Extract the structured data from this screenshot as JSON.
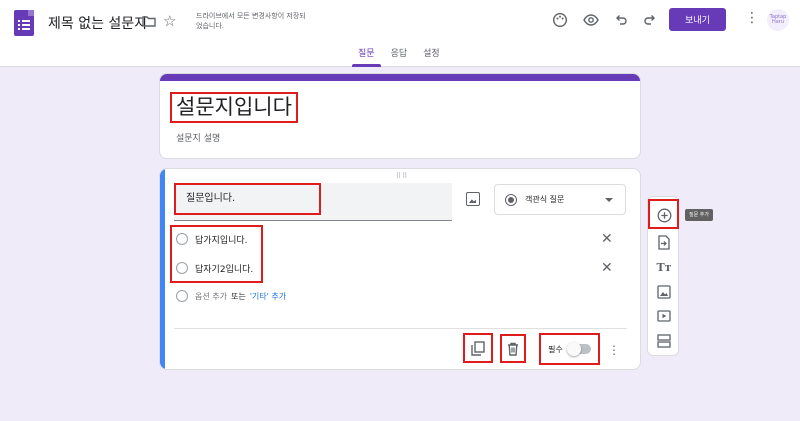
{
  "header": {
    "doc_title": "제목 없는 설문지",
    "save_status": "드라이브에서 모든 변경사항이 저장되었습니다.",
    "send_label": "보내기",
    "avatar_text": "Taptap Haru"
  },
  "tabs": [
    {
      "label": "질문",
      "active": true
    },
    {
      "label": "응답",
      "active": false
    },
    {
      "label": "설정",
      "active": false
    }
  ],
  "form": {
    "title": "설문지입니다",
    "description": "설문지 설명"
  },
  "question": {
    "text": "질문입니다.",
    "type_label": "객관식 질문",
    "options": [
      "답가지입니다.",
      "답자기2입니다."
    ],
    "add_option": "옵션 추가",
    "add_option_or": "또는",
    "add_other": "'기타' 추가",
    "required_label": "필수",
    "required": false
  },
  "toolbar": {
    "tooltip": "질문 추가"
  },
  "colors": {
    "brand": "#673ab7",
    "accent_blue": "#4285f4",
    "highlight_red": "#e01b1b",
    "page_bg": "#f0ebf8"
  }
}
